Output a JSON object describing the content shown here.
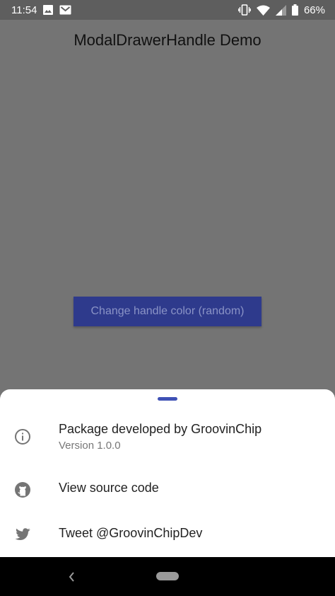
{
  "status_bar": {
    "time": "11:54",
    "left_icons": [
      "image-icon",
      "gmail-icon"
    ],
    "right_icons": [
      "vibrate-icon",
      "wifi-icon",
      "signal-icon",
      "battery-icon"
    ],
    "battery": "66%"
  },
  "app_bar": {
    "title": "ModalDrawerHandle Demo"
  },
  "main": {
    "button_label": "Change handle color (random)"
  },
  "sheet": {
    "handle_color": "#3f51b5",
    "items": [
      {
        "icon": "info-icon",
        "title": "Package developed by GroovinChip",
        "subtitle": "Version 1.0.0"
      },
      {
        "icon": "github-icon",
        "title": "View source code"
      },
      {
        "icon": "twitter-icon",
        "title": "Tweet @GroovinChipDev"
      }
    ]
  },
  "colors": {
    "scrim": "#747474",
    "button": "#2e3a8c",
    "button_text": "#8a93c6",
    "handle": "#3f51b5"
  }
}
